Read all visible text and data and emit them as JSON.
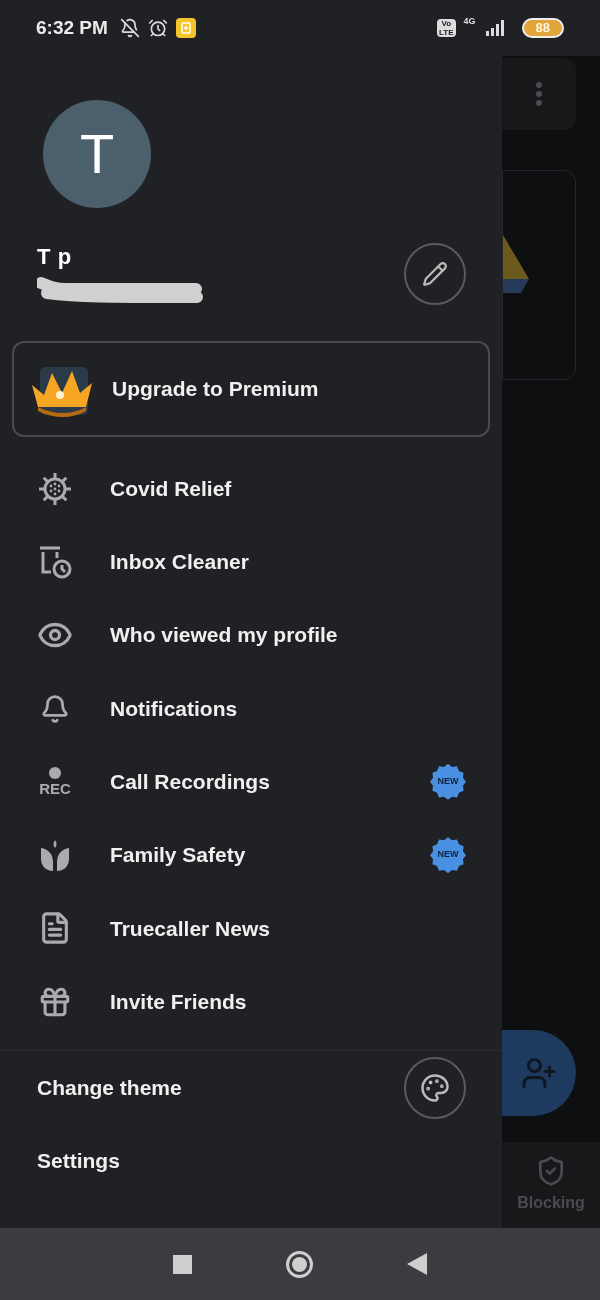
{
  "status_bar": {
    "time": "6:32 PM",
    "volte_top": "Vo",
    "volte_bottom": "LTE",
    "network": "4G",
    "battery": "88"
  },
  "profile": {
    "avatar_letter": "T",
    "name": "T p"
  },
  "premium": {
    "label": "Upgrade to Premium"
  },
  "menu": [
    {
      "kind": "virus",
      "label": "Covid Relief"
    },
    {
      "kind": "inbox_cleaner",
      "label": "Inbox Cleaner"
    },
    {
      "kind": "eye",
      "label": "Who viewed my profile"
    },
    {
      "kind": "bell",
      "label": "Notifications"
    },
    {
      "kind": "rec",
      "icon_text": "REC",
      "label": "Call Recordings",
      "badge": "NEW"
    },
    {
      "kind": "tulip",
      "label": "Family Safety",
      "badge": "NEW"
    },
    {
      "kind": "news",
      "label": "Truecaller News"
    },
    {
      "kind": "gift",
      "label": "Invite Friends"
    }
  ],
  "footer": [
    {
      "kind": "theme",
      "label": "Change theme"
    },
    {
      "kind": "plain",
      "label": "Settings"
    }
  ],
  "background": {
    "tab_label": "Blocking"
  }
}
